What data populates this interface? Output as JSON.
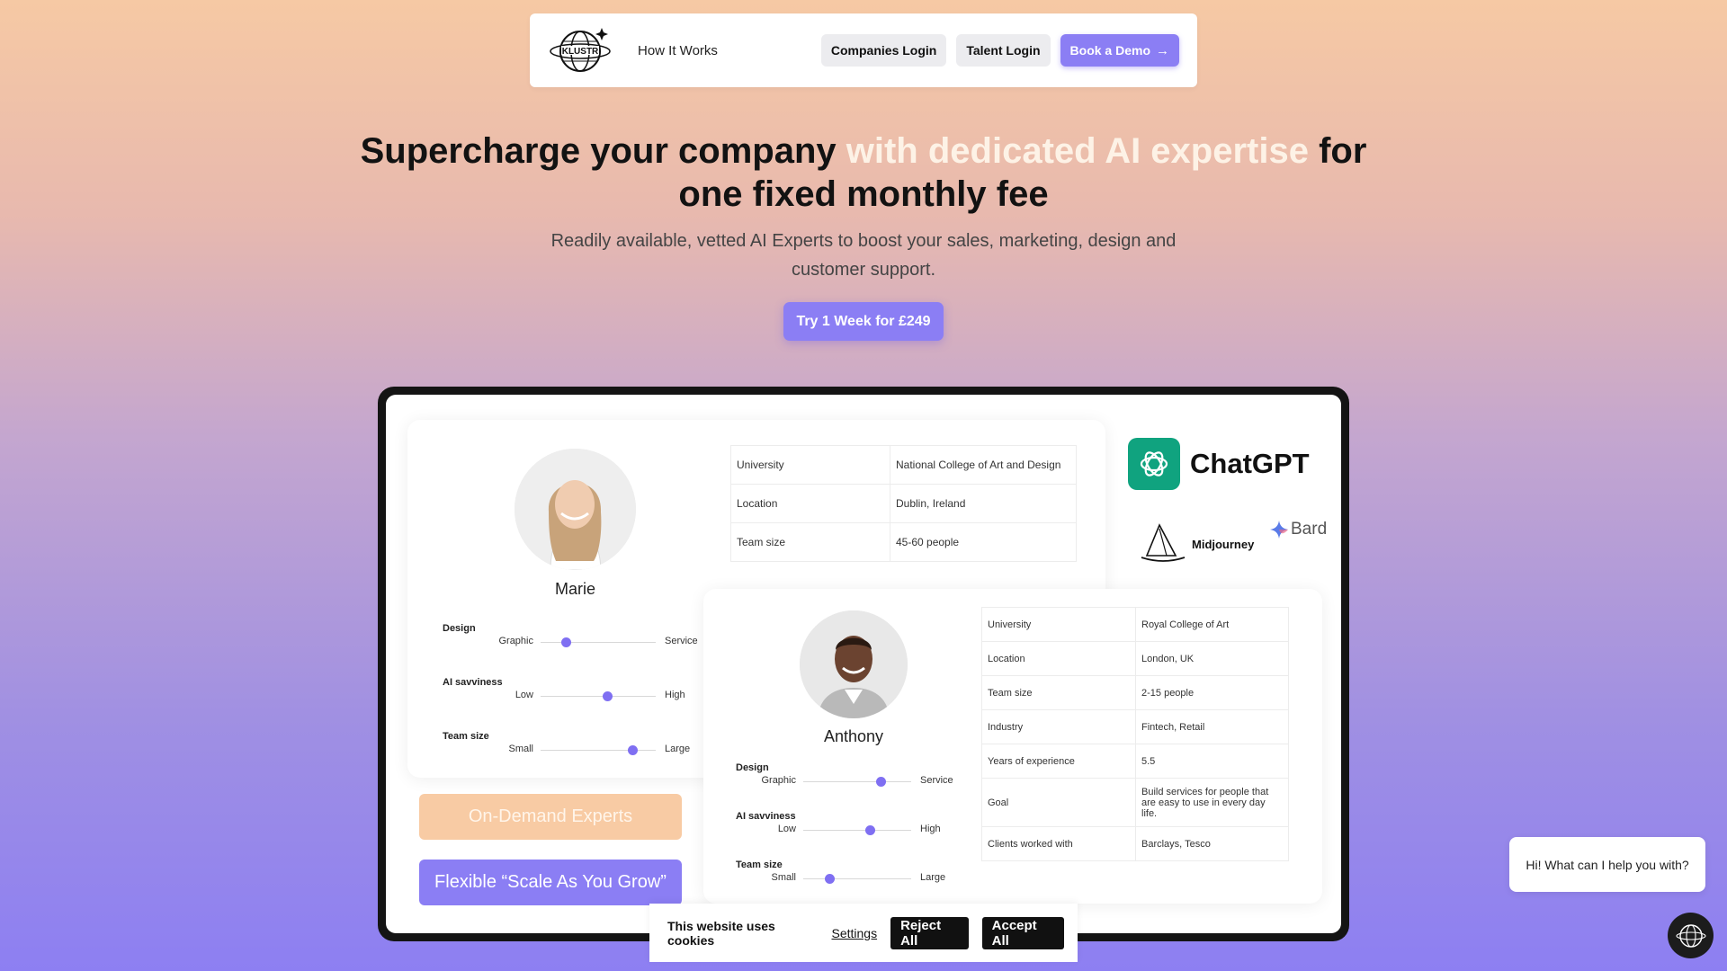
{
  "nav": {
    "how_it_works": "How It Works",
    "companies_login": "Companies Login",
    "talent_login": "Talent Login",
    "book_demo": "Book a Demo",
    "logo_text": "KLUSTR"
  },
  "hero": {
    "title_part1": "Supercharge your company ",
    "title_highlight": "with dedicated AI expertise",
    "title_part2": " for one fixed monthly fee",
    "subtitle": "Readily available, vetted AI Experts to boost your sales, marketing, design and customer support.",
    "cta": "Try 1 Week for £249"
  },
  "card_marie": {
    "name": "Marie",
    "sliders": [
      {
        "label": "Design",
        "left": "Graphic",
        "right": "Service",
        "value": 0.22
      },
      {
        "label": "AI savviness",
        "left": "Low",
        "right": "High",
        "value": 0.58
      },
      {
        "label": "Team size",
        "left": "Small",
        "right": "Large",
        "value": 0.8
      }
    ],
    "table": [
      {
        "k": "University",
        "v": "National College of Art and Design"
      },
      {
        "k": "Location",
        "v": "Dublin, Ireland"
      },
      {
        "k": "Team size",
        "v": "45-60 people"
      }
    ]
  },
  "card_anthony": {
    "name": "Anthony",
    "sliders": [
      {
        "label": "Design",
        "left": "Graphic",
        "right": "Service",
        "value": 0.72
      },
      {
        "label": "AI savviness",
        "left": "Low",
        "right": "High",
        "value": 0.62
      },
      {
        "label": "Team size",
        "left": "Small",
        "right": "Large",
        "value": 0.24
      }
    ],
    "table": [
      {
        "k": "University",
        "v": "Royal College of Art"
      },
      {
        "k": "Location",
        "v": "London, UK"
      },
      {
        "k": "Team size",
        "v": "2-15 people"
      },
      {
        "k": "Industry",
        "v": "Fintech, Retail"
      },
      {
        "k": "Years of experience",
        "v": "5.5"
      },
      {
        "k": "Goal",
        "v": "Build services for people that are easy to use in every day life."
      },
      {
        "k": "Clients worked with",
        "v": "Barclays, Tesco"
      }
    ]
  },
  "pills": {
    "on_demand": "On-Demand Experts",
    "flexible": "Flexible “Scale As You Grow”"
  },
  "tools": {
    "chatgpt": "ChatGPT",
    "midjourney": "Midjourney",
    "bard": "Bard"
  },
  "chat": {
    "bubble": "Hi! What can I help you with?"
  },
  "cookie": {
    "text": "This website uses cookies",
    "settings": "Settings",
    "reject": "Reject All",
    "accept": "Accept All"
  },
  "colors": {
    "accent": "#8b7ef4",
    "peach": "#f8cba4",
    "chatgpt_green": "#10a37f"
  }
}
